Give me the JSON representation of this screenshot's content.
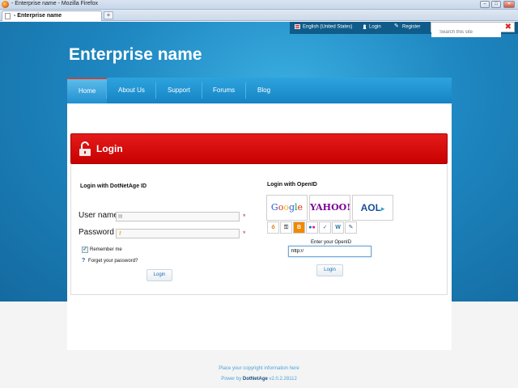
{
  "browser": {
    "window_title": "- Enterprise name - Mozilla Firefox",
    "tab_title": "- Enterprise name",
    "new_tab": "+"
  },
  "topbar": {
    "language": "English (United States)",
    "login": "Login",
    "register": "Register",
    "search_placeholder": "Search this site",
    "search_clear": "✖"
  },
  "site": {
    "title": "Enterprise name"
  },
  "nav": {
    "items": [
      {
        "label": "Home",
        "active": true
      },
      {
        "label": "About Us"
      },
      {
        "label": "Support"
      },
      {
        "label": "Forums"
      },
      {
        "label": "Blog"
      }
    ]
  },
  "login": {
    "header": "Login",
    "local": {
      "title": "Login with DotNetAge ID",
      "user_label": "User name",
      "password_label": "Password",
      "required_mark": "*",
      "remember": "Remember me",
      "forgot": "Forget your password?",
      "button": "Login"
    },
    "openid": {
      "title": "Login with OpenID",
      "providers": [
        "Google",
        "YAHOO!",
        "AOL"
      ],
      "caption": "Enter your OpenID",
      "value": "http://",
      "button": "Login"
    }
  },
  "footer": {
    "copyright": "Place your copyright information here",
    "powered_prefix": "Power by",
    "powered_brand": "DotNetAge",
    "powered_version": "v2.0.2.28112"
  },
  "colors": {
    "accent": "#1683c4",
    "login_header": "#d60000",
    "link": "#1a6fb5"
  }
}
